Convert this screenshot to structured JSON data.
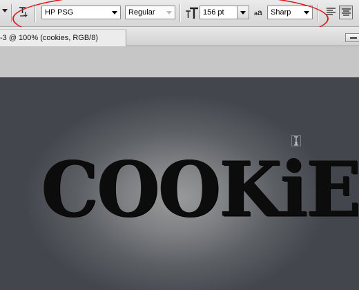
{
  "options_bar": {
    "tool_menu_icon": "dropdown-arrow-icon",
    "orientation_icon": "toggle-text-orientation-icon",
    "font_family": "HP PSG",
    "font_style": "Regular",
    "font_size_icon": "font-size-icon",
    "font_size": "156 pt",
    "antialias_icon_label": "a",
    "antialias_icon_label_small": "a",
    "antialias": "Sharp",
    "align_left_icon": "align-left-icon",
    "align_center_icon": "align-center-icon",
    "highlight_color": "#d81c1c"
  },
  "document": {
    "tab_title": "-3 @ 100% (cookies, RGB/8)"
  },
  "canvas": {
    "text": "COOKiES",
    "cursor_icon": "text-ibeam-cursor-icon"
  }
}
